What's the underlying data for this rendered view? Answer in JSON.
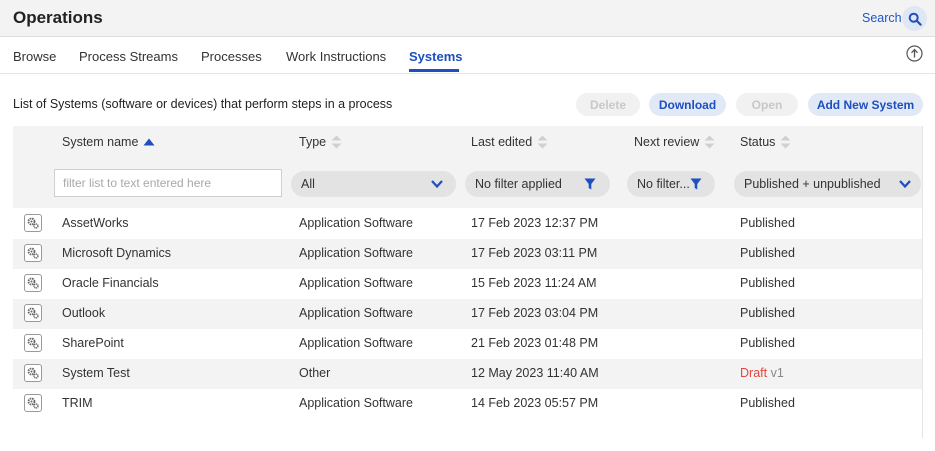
{
  "app": {
    "title": "Operations",
    "search_label": "Search"
  },
  "tabs": [
    {
      "label": "Browse"
    },
    {
      "label": "Process Streams"
    },
    {
      "label": "Processes"
    },
    {
      "label": "Work Instructions"
    },
    {
      "label": "Systems",
      "active": true
    }
  ],
  "toolbar": {
    "description": "List of Systems (software or devices) that perform steps in a process",
    "delete_label": "Delete",
    "download_label": "Download",
    "open_label": "Open",
    "add_label": "Add New System"
  },
  "columns": {
    "name": "System name",
    "type": "Type",
    "last_edited": "Last edited",
    "next_review": "Next review",
    "status": "Status"
  },
  "filters": {
    "name_placeholder": "filter list to text entered here",
    "type": "All",
    "last_edited": "No filter applied",
    "next_review": "No filter...",
    "status": "Published + unpublished"
  },
  "rows": [
    {
      "name": "AssetWorks",
      "type": "Application Software",
      "edited": "17 Feb 2023 12:37 PM",
      "review": "",
      "status": "Published",
      "version": ""
    },
    {
      "name": "Microsoft Dynamics",
      "type": "Application Software",
      "edited": "17 Feb 2023 03:11 PM",
      "review": "",
      "status": "Published",
      "version": ""
    },
    {
      "name": "Oracle Financials",
      "type": "Application Software",
      "edited": "15 Feb 2023 11:24 AM",
      "review": "",
      "status": "Published",
      "version": ""
    },
    {
      "name": "Outlook",
      "type": "Application Software",
      "edited": "17 Feb 2023 03:04 PM",
      "review": "",
      "status": "Published",
      "version": ""
    },
    {
      "name": "SharePoint",
      "type": "Application Software",
      "edited": "21 Feb 2023 01:48 PM",
      "review": "",
      "status": "Published",
      "version": ""
    },
    {
      "name": "System Test",
      "type": "Other",
      "edited": "12 May 2023 11:40 AM",
      "review": "",
      "status": "Draft",
      "version": "v1"
    },
    {
      "name": "TRIM",
      "type": "Application Software",
      "edited": "14 Feb 2023 05:57 PM",
      "review": "",
      "status": "Published",
      "version": ""
    }
  ],
  "colors": {
    "accent": "#1d4fbf",
    "draft": "#e0483f",
    "header_bg": "#f3f3f3",
    "filter_bg": "#e3e3e3"
  },
  "icons": {
    "search": "search-icon",
    "upload": "upload-icon",
    "sort": "sort-icon",
    "filter": "funnel-icon",
    "dropdown": "chevron-down-icon",
    "system": "gears-icon"
  }
}
